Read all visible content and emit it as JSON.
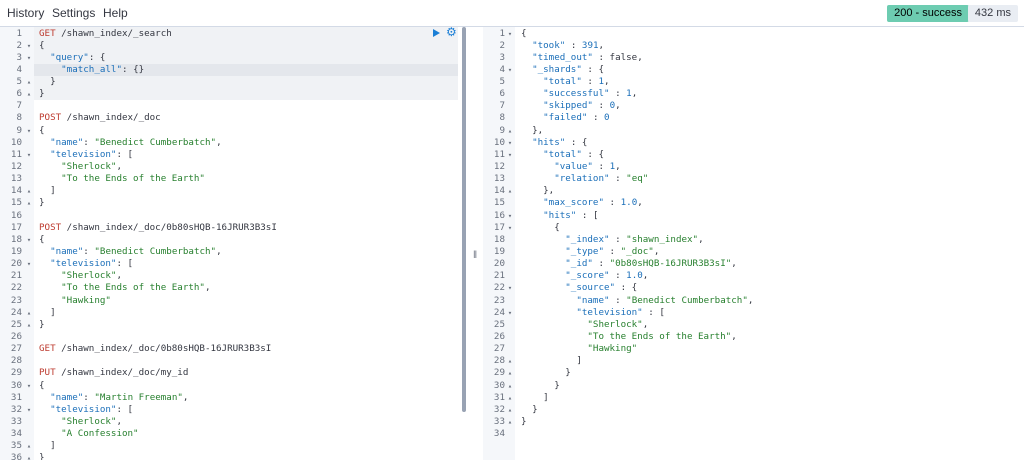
{
  "menu": {
    "history": "History",
    "settings": "Settings",
    "help": "Help"
  },
  "status": {
    "response": "200 - success",
    "time": "432 ms"
  },
  "request_lines": [
    {
      "n": "1",
      "f": "",
      "t": "GET /shawn_index/_search"
    },
    {
      "n": "2",
      "f": "▾",
      "t": "{"
    },
    {
      "n": "3",
      "f": "▾",
      "t": "  \"query\": {"
    },
    {
      "n": "4",
      "f": "",
      "t": "    \"match_all\": {}"
    },
    {
      "n": "5",
      "f": "▴",
      "t": "  }"
    },
    {
      "n": "6",
      "f": "▴",
      "t": "}"
    },
    {
      "n": "7",
      "f": "",
      "t": ""
    },
    {
      "n": "8",
      "f": "",
      "t": "POST /shawn_index/_doc"
    },
    {
      "n": "9",
      "f": "▾",
      "t": "{"
    },
    {
      "n": "10",
      "f": "",
      "t": "  \"name\": \"Benedict Cumberbatch\","
    },
    {
      "n": "11",
      "f": "▾",
      "t": "  \"television\": ["
    },
    {
      "n": "12",
      "f": "",
      "t": "    \"Sherlock\","
    },
    {
      "n": "13",
      "f": "",
      "t": "    \"To the Ends of the Earth\""
    },
    {
      "n": "14",
      "f": "▴",
      "t": "  ]"
    },
    {
      "n": "15",
      "f": "▴",
      "t": "}"
    },
    {
      "n": "16",
      "f": "",
      "t": ""
    },
    {
      "n": "17",
      "f": "",
      "t": "POST /shawn_index/_doc/0b80sHQB-16JRUR3B3sI"
    },
    {
      "n": "18",
      "f": "▾",
      "t": "{"
    },
    {
      "n": "19",
      "f": "",
      "t": "  \"name\": \"Benedict Cumberbatch\","
    },
    {
      "n": "20",
      "f": "▾",
      "t": "  \"television\": ["
    },
    {
      "n": "21",
      "f": "",
      "t": "    \"Sherlock\","
    },
    {
      "n": "22",
      "f": "",
      "t": "    \"To the Ends of the Earth\","
    },
    {
      "n": "23",
      "f": "",
      "t": "    \"Hawking\""
    },
    {
      "n": "24",
      "f": "▴",
      "t": "  ]"
    },
    {
      "n": "25",
      "f": "▴",
      "t": "}"
    },
    {
      "n": "26",
      "f": "",
      "t": ""
    },
    {
      "n": "27",
      "f": "",
      "t": "GET /shawn_index/_doc/0b80sHQB-16JRUR3B3sI"
    },
    {
      "n": "28",
      "f": "",
      "t": ""
    },
    {
      "n": "29",
      "f": "",
      "t": "PUT /shawn_index/_doc/my_id"
    },
    {
      "n": "30",
      "f": "▾",
      "t": "{"
    },
    {
      "n": "31",
      "f": "",
      "t": "  \"name\": \"Martin Freeman\","
    },
    {
      "n": "32",
      "f": "▾",
      "t": "  \"television\": ["
    },
    {
      "n": "33",
      "f": "",
      "t": "    \"Sherlock\","
    },
    {
      "n": "34",
      "f": "",
      "t": "    \"A Confession\""
    },
    {
      "n": "35",
      "f": "▴",
      "t": "  ]"
    },
    {
      "n": "36",
      "f": "▴",
      "t": "}"
    }
  ],
  "response_lines": [
    {
      "n": "1",
      "f": "▾",
      "t": "{"
    },
    {
      "n": "2",
      "f": "",
      "t": "  \"took\" : 391,"
    },
    {
      "n": "3",
      "f": "",
      "t": "  \"timed_out\" : false,"
    },
    {
      "n": "4",
      "f": "▾",
      "t": "  \"_shards\" : {"
    },
    {
      "n": "5",
      "f": "",
      "t": "    \"total\" : 1,"
    },
    {
      "n": "6",
      "f": "",
      "t": "    \"successful\" : 1,"
    },
    {
      "n": "7",
      "f": "",
      "t": "    \"skipped\" : 0,"
    },
    {
      "n": "8",
      "f": "",
      "t": "    \"failed\" : 0"
    },
    {
      "n": "9",
      "f": "▴",
      "t": "  },"
    },
    {
      "n": "10",
      "f": "▾",
      "t": "  \"hits\" : {"
    },
    {
      "n": "11",
      "f": "▾",
      "t": "    \"total\" : {"
    },
    {
      "n": "12",
      "f": "",
      "t": "      \"value\" : 1,"
    },
    {
      "n": "13",
      "f": "",
      "t": "      \"relation\" : \"eq\""
    },
    {
      "n": "14",
      "f": "▴",
      "t": "    },"
    },
    {
      "n": "15",
      "f": "",
      "t": "    \"max_score\" : 1.0,"
    },
    {
      "n": "16",
      "f": "▾",
      "t": "    \"hits\" : ["
    },
    {
      "n": "17",
      "f": "▾",
      "t": "      {"
    },
    {
      "n": "18",
      "f": "",
      "t": "        \"_index\" : \"shawn_index\","
    },
    {
      "n": "19",
      "f": "",
      "t": "        \"_type\" : \"_doc\","
    },
    {
      "n": "20",
      "f": "",
      "t": "        \"_id\" : \"0b80sHQB-16JRUR3B3sI\","
    },
    {
      "n": "21",
      "f": "",
      "t": "        \"_score\" : 1.0,"
    },
    {
      "n": "22",
      "f": "▾",
      "t": "        \"_source\" : {"
    },
    {
      "n": "23",
      "f": "",
      "t": "          \"name\" : \"Benedict Cumberbatch\","
    },
    {
      "n": "24",
      "f": "▾",
      "t": "          \"television\" : ["
    },
    {
      "n": "25",
      "f": "",
      "t": "            \"Sherlock\","
    },
    {
      "n": "26",
      "f": "",
      "t": "            \"To the Ends of the Earth\","
    },
    {
      "n": "27",
      "f": "",
      "t": "            \"Hawking\""
    },
    {
      "n": "28",
      "f": "▴",
      "t": "          ]"
    },
    {
      "n": "29",
      "f": "▴",
      "t": "        }"
    },
    {
      "n": "30",
      "f": "▴",
      "t": "      }"
    },
    {
      "n": "31",
      "f": "▴",
      "t": "    ]"
    },
    {
      "n": "32",
      "f": "▴",
      "t": "  }"
    },
    {
      "n": "33",
      "f": "▴",
      "t": "}"
    },
    {
      "n": "34",
      "f": "",
      "t": ""
    }
  ],
  "icons": {
    "run": "play-icon",
    "settings": "wrench-icon",
    "resize": "drag-handle-icon"
  },
  "colors": {
    "success_badge": "#6dccb1",
    "method": "#bd3b2f",
    "key": "#1b6fb9",
    "string": "#28802f"
  }
}
